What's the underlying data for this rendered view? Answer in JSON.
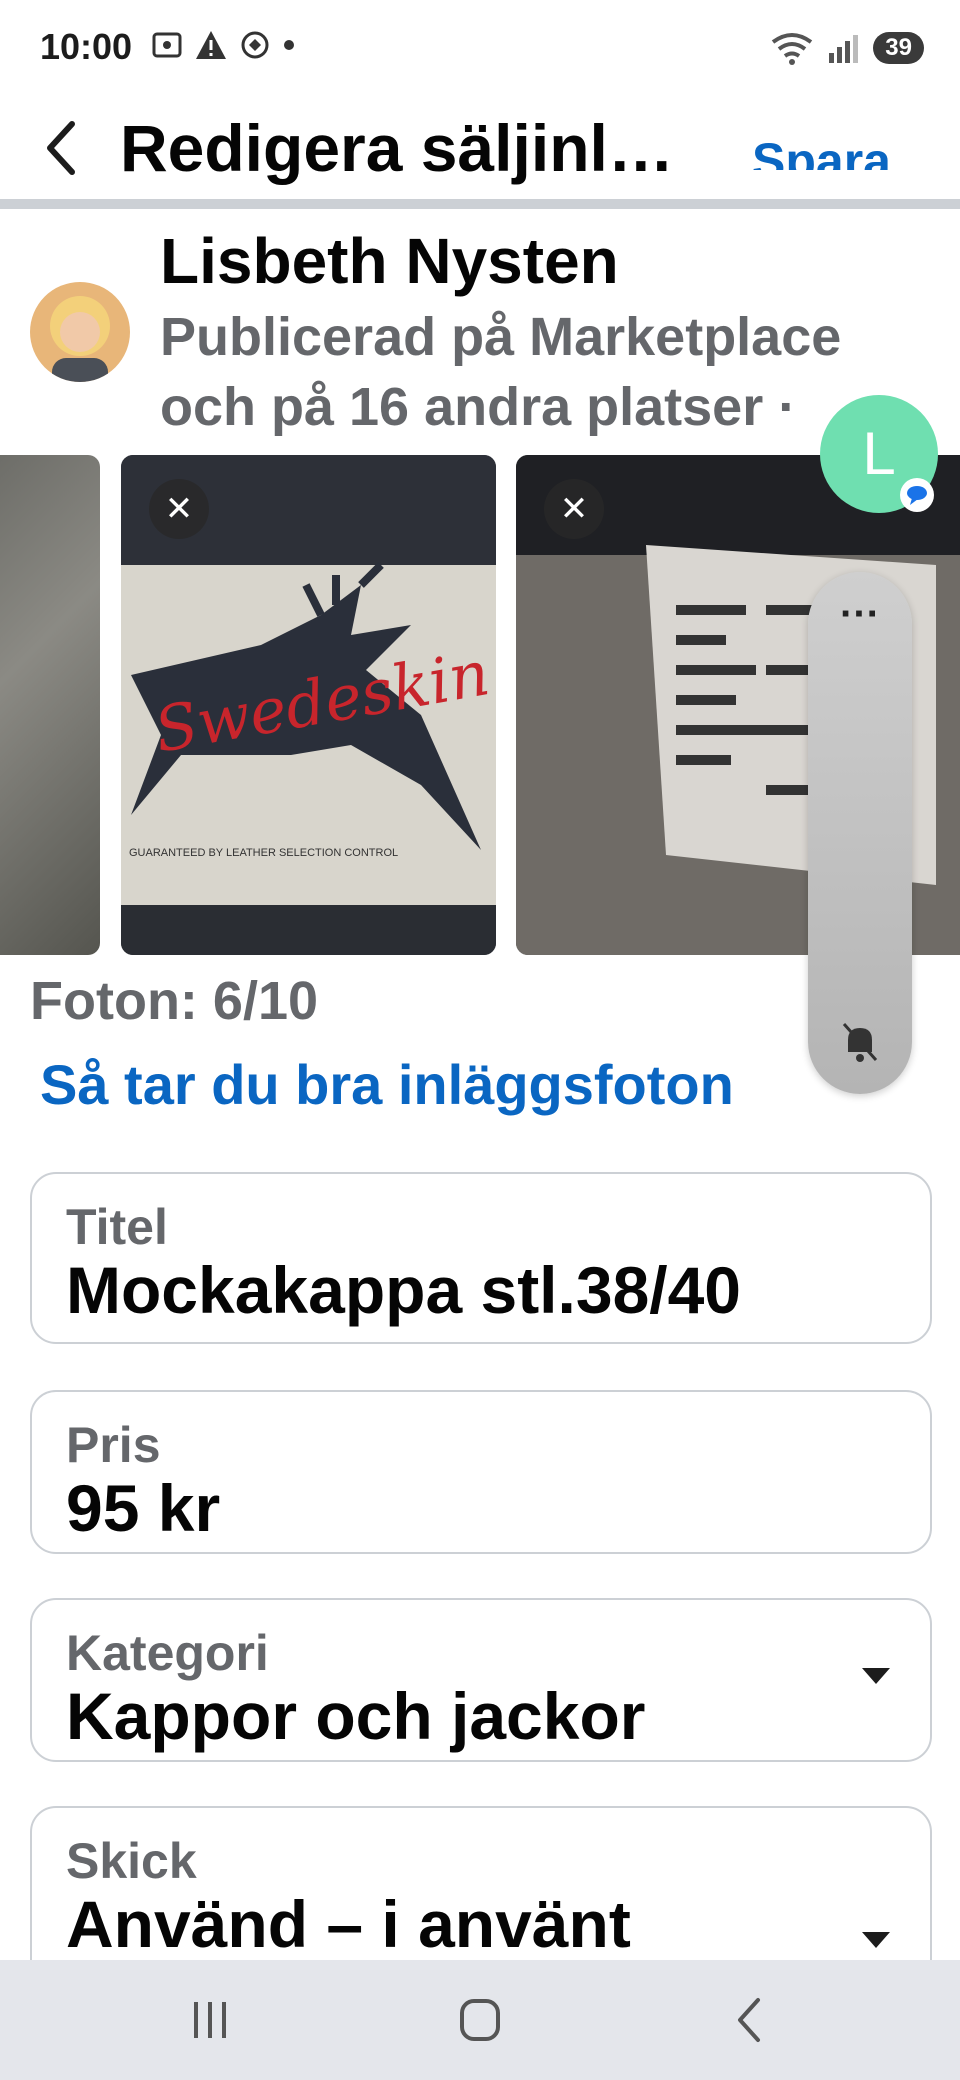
{
  "status_bar": {
    "time": "10:00",
    "battery": "39"
  },
  "header": {
    "title": "Redigera säljinl…",
    "save_label": "Spara"
  },
  "profile": {
    "name": "Lisbeth Nysten",
    "subtitle": "Publicerad på Marketplace och på 16 andra platser ·"
  },
  "photos": {
    "count_label": "Foton: 6/10",
    "tips_link": "Så tar du bra inläggsfoton",
    "label_text": "Swedeskin",
    "label_small": "GUARANTEED BY LEATHER SELECTION CONTROL"
  },
  "fields": {
    "title": {
      "label": "Titel",
      "value": "Mockakappa stl.38/40"
    },
    "price": {
      "label": "Pris",
      "value": "95 kr"
    },
    "category": {
      "label": "Kategori",
      "value": "Kappor och jackor"
    },
    "condition": {
      "label": "Skick",
      "value": "Använd – i använt"
    }
  },
  "chat_head": {
    "initial": "L",
    "color": "#6fdfb0"
  },
  "side_panel": {
    "menu_label": "···"
  },
  "colors": {
    "accent": "#0a66c2",
    "secondary_text": "#65676b",
    "border": "#ccd0d5"
  }
}
